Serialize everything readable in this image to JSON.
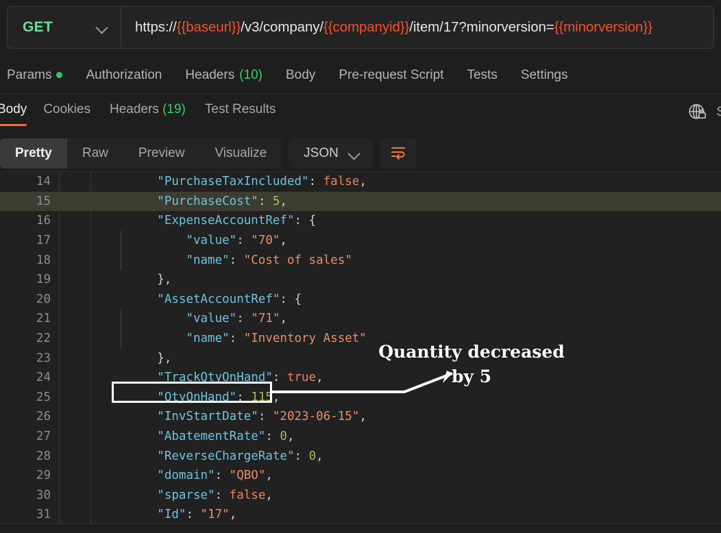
{
  "request_bar": {
    "method": "GET",
    "method_chevron_icon": "chevron-down-icon",
    "url_segments": [
      {
        "text": "https://",
        "kind": "plain"
      },
      {
        "text": "{{baseurl}}",
        "kind": "var"
      },
      {
        "text": "/v3/company/",
        "kind": "plain"
      },
      {
        "text": "{{companyid}}",
        "kind": "var"
      },
      {
        "text": "/item/17?minorversion=",
        "kind": "plain"
      },
      {
        "text": "{{minorversion}}",
        "kind": "var"
      }
    ],
    "url_full": "https://{{baseurl}}/v3/company/{{companyid}}/item/17?minorversion={{minorversion}}",
    "variable_color": "#F5512C",
    "method_color": "#6BDD9A"
  },
  "request_tabs": [
    {
      "label": "Params",
      "badge": "",
      "dot": true
    },
    {
      "label": "Authorization",
      "badge": "",
      "dot": false
    },
    {
      "label": "Headers",
      "badge": "(10)",
      "dot": false
    },
    {
      "label": "Body",
      "badge": "",
      "dot": false
    },
    {
      "label": "Pre-request Script",
      "badge": "",
      "dot": false
    },
    {
      "label": "Tests",
      "badge": "",
      "dot": false
    },
    {
      "label": "Settings",
      "badge": "",
      "dot": false
    }
  ],
  "response_tabs": [
    {
      "label": "Body",
      "badge": "",
      "active": true
    },
    {
      "label": "Cookies",
      "badge": "",
      "active": false
    },
    {
      "label": "Headers",
      "badge": "(19)",
      "active": false
    },
    {
      "label": "Test Results",
      "badge": "",
      "active": false
    }
  ],
  "response_right": {
    "globe_lock_icon": "globe-lock-icon",
    "truncated_label": "S"
  },
  "view_toolbar": {
    "view_modes": [
      {
        "label": "Pretty",
        "active": true
      },
      {
        "label": "Raw",
        "active": false
      },
      {
        "label": "Preview",
        "active": false
      },
      {
        "label": "Visualize",
        "active": false
      }
    ],
    "format": "JSON",
    "format_chevron_icon": "chevron-down-icon",
    "wrap_icon": "word-wrap-icon",
    "accent_color": "#FF6C37"
  },
  "code": {
    "highlighted_line": 15,
    "lines": [
      {
        "num": "14",
        "indent": 2,
        "guide": false,
        "tokens": [
          {
            "t": "\"PurchaseTaxIncluded\"",
            "c": "k"
          },
          {
            "t": ": ",
            "c": "p"
          },
          {
            "t": "false",
            "c": "b"
          },
          {
            "t": ",",
            "c": "p"
          }
        ]
      },
      {
        "num": "15",
        "indent": 2,
        "guide": false,
        "tokens": [
          {
            "t": "\"PurchaseCost\"",
            "c": "k"
          },
          {
            "t": ": ",
            "c": "p"
          },
          {
            "t": "5",
            "c": "n"
          },
          {
            "t": ",",
            "c": "p"
          }
        ]
      },
      {
        "num": "16",
        "indent": 2,
        "guide": false,
        "tokens": [
          {
            "t": "\"ExpenseAccountRef\"",
            "c": "k"
          },
          {
            "t": ": ",
            "c": "p"
          },
          {
            "t": "{",
            "c": "p"
          }
        ]
      },
      {
        "num": "17",
        "indent": 3,
        "guide": true,
        "tokens": [
          {
            "t": "\"value\"",
            "c": "k"
          },
          {
            "t": ": ",
            "c": "p"
          },
          {
            "t": "\"70\"",
            "c": "s"
          },
          {
            "t": ",",
            "c": "p"
          }
        ]
      },
      {
        "num": "18",
        "indent": 3,
        "guide": true,
        "tokens": [
          {
            "t": "\"name\"",
            "c": "k"
          },
          {
            "t": ": ",
            "c": "p"
          },
          {
            "t": "\"Cost of sales\"",
            "c": "s"
          }
        ]
      },
      {
        "num": "19",
        "indent": 2,
        "guide": false,
        "tokens": [
          {
            "t": "},",
            "c": "p"
          }
        ]
      },
      {
        "num": "20",
        "indent": 2,
        "guide": false,
        "tokens": [
          {
            "t": "\"AssetAccountRef\"",
            "c": "k"
          },
          {
            "t": ": ",
            "c": "p"
          },
          {
            "t": "{",
            "c": "p"
          }
        ]
      },
      {
        "num": "21",
        "indent": 3,
        "guide": true,
        "tokens": [
          {
            "t": "\"value\"",
            "c": "k"
          },
          {
            "t": ": ",
            "c": "p"
          },
          {
            "t": "\"71\"",
            "c": "s"
          },
          {
            "t": ",",
            "c": "p"
          }
        ]
      },
      {
        "num": "22",
        "indent": 3,
        "guide": true,
        "tokens": [
          {
            "t": "\"name\"",
            "c": "k"
          },
          {
            "t": ": ",
            "c": "p"
          },
          {
            "t": "\"Inventory Asset\"",
            "c": "s"
          }
        ]
      },
      {
        "num": "23",
        "indent": 2,
        "guide": false,
        "tokens": [
          {
            "t": "},",
            "c": "p"
          }
        ]
      },
      {
        "num": "24",
        "indent": 2,
        "guide": false,
        "tokens": [
          {
            "t": "\"TrackQtyOnHand\"",
            "c": "k"
          },
          {
            "t": ": ",
            "c": "p"
          },
          {
            "t": "true",
            "c": "b"
          },
          {
            "t": ",",
            "c": "p"
          }
        ]
      },
      {
        "num": "25",
        "indent": 2,
        "guide": false,
        "tokens": [
          {
            "t": "\"QtyOnHand\"",
            "c": "k"
          },
          {
            "t": ": ",
            "c": "p"
          },
          {
            "t": "115",
            "c": "n"
          },
          {
            "t": ",",
            "c": "p"
          }
        ]
      },
      {
        "num": "26",
        "indent": 2,
        "guide": false,
        "tokens": [
          {
            "t": "\"InvStartDate\"",
            "c": "k"
          },
          {
            "t": ": ",
            "c": "p"
          },
          {
            "t": "\"2023-06-15\"",
            "c": "s"
          },
          {
            "t": ",",
            "c": "p"
          }
        ]
      },
      {
        "num": "27",
        "indent": 2,
        "guide": false,
        "tokens": [
          {
            "t": "\"AbatementRate\"",
            "c": "k"
          },
          {
            "t": ": ",
            "c": "p"
          },
          {
            "t": "0",
            "c": "n"
          },
          {
            "t": ",",
            "c": "p"
          }
        ]
      },
      {
        "num": "28",
        "indent": 2,
        "guide": false,
        "tokens": [
          {
            "t": "\"ReverseChargeRate\"",
            "c": "k"
          },
          {
            "t": ": ",
            "c": "p"
          },
          {
            "t": "0",
            "c": "n"
          },
          {
            "t": ",",
            "c": "p"
          }
        ]
      },
      {
        "num": "29",
        "indent": 2,
        "guide": false,
        "tokens": [
          {
            "t": "\"domain\"",
            "c": "k"
          },
          {
            "t": ": ",
            "c": "p"
          },
          {
            "t": "\"QBO\"",
            "c": "s"
          },
          {
            "t": ",",
            "c": "p"
          }
        ]
      },
      {
        "num": "30",
        "indent": 2,
        "guide": false,
        "tokens": [
          {
            "t": "\"sparse\"",
            "c": "k"
          },
          {
            "t": ": ",
            "c": "p"
          },
          {
            "t": "false",
            "c": "b"
          },
          {
            "t": ",",
            "c": "p"
          }
        ]
      },
      {
        "num": "31",
        "indent": 2,
        "guide": false,
        "tokens": [
          {
            "t": "\"Id\"",
            "c": "k"
          },
          {
            "t": ": ",
            "c": "p"
          },
          {
            "t": "\"17\"",
            "c": "s"
          },
          {
            "t": ",",
            "c": "p"
          }
        ]
      }
    ]
  },
  "annotation": {
    "line1": "Quantity decreased",
    "line2": "by 5",
    "highlight_target": "\"QtyOnHand\": 115,",
    "color": "#ffffff"
  }
}
